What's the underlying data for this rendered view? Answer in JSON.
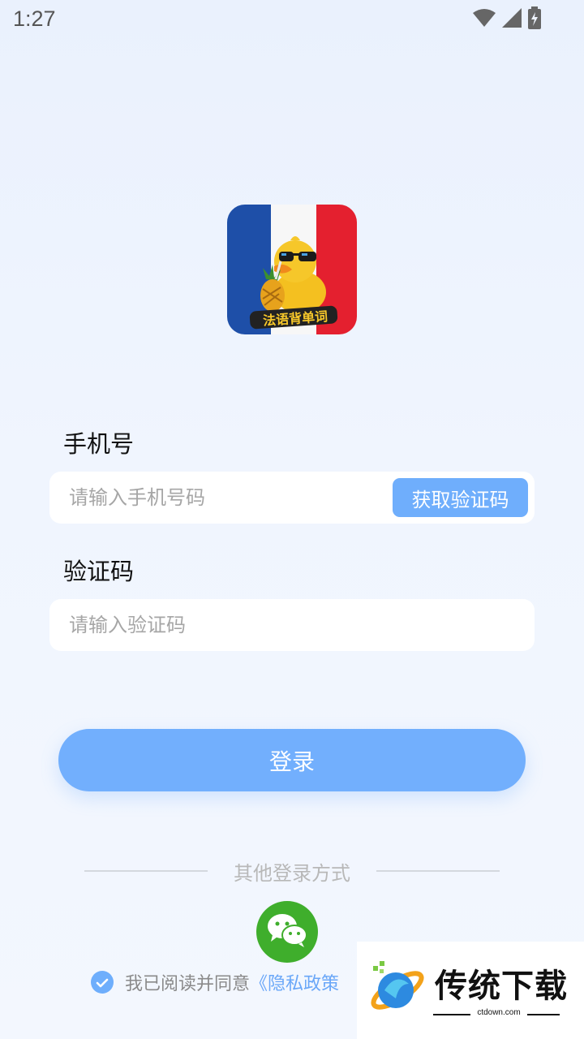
{
  "status_bar": {
    "time": "1:27"
  },
  "logo": {
    "text": "法语背单词"
  },
  "phone": {
    "label": "手机号",
    "placeholder": "请输入手机号码",
    "value": "",
    "get_code_label": "获取验证码"
  },
  "code": {
    "label": "验证码",
    "placeholder": "请输入验证码",
    "value": ""
  },
  "login_label": "登录",
  "other_login": {
    "label": "其他登录方式",
    "methods": [
      {
        "name": "wechat",
        "icon": "wechat-icon"
      }
    ]
  },
  "agreement": {
    "checked": true,
    "text": "我已阅读并同意",
    "privacy_link": "《隐私政策"
  },
  "watermark": {
    "name": "传统下载",
    "url": "ctdown.com"
  },
  "colors": {
    "accent": "#72affd",
    "wechat_green": "#3fae2c",
    "link": "#6aa7f8"
  }
}
